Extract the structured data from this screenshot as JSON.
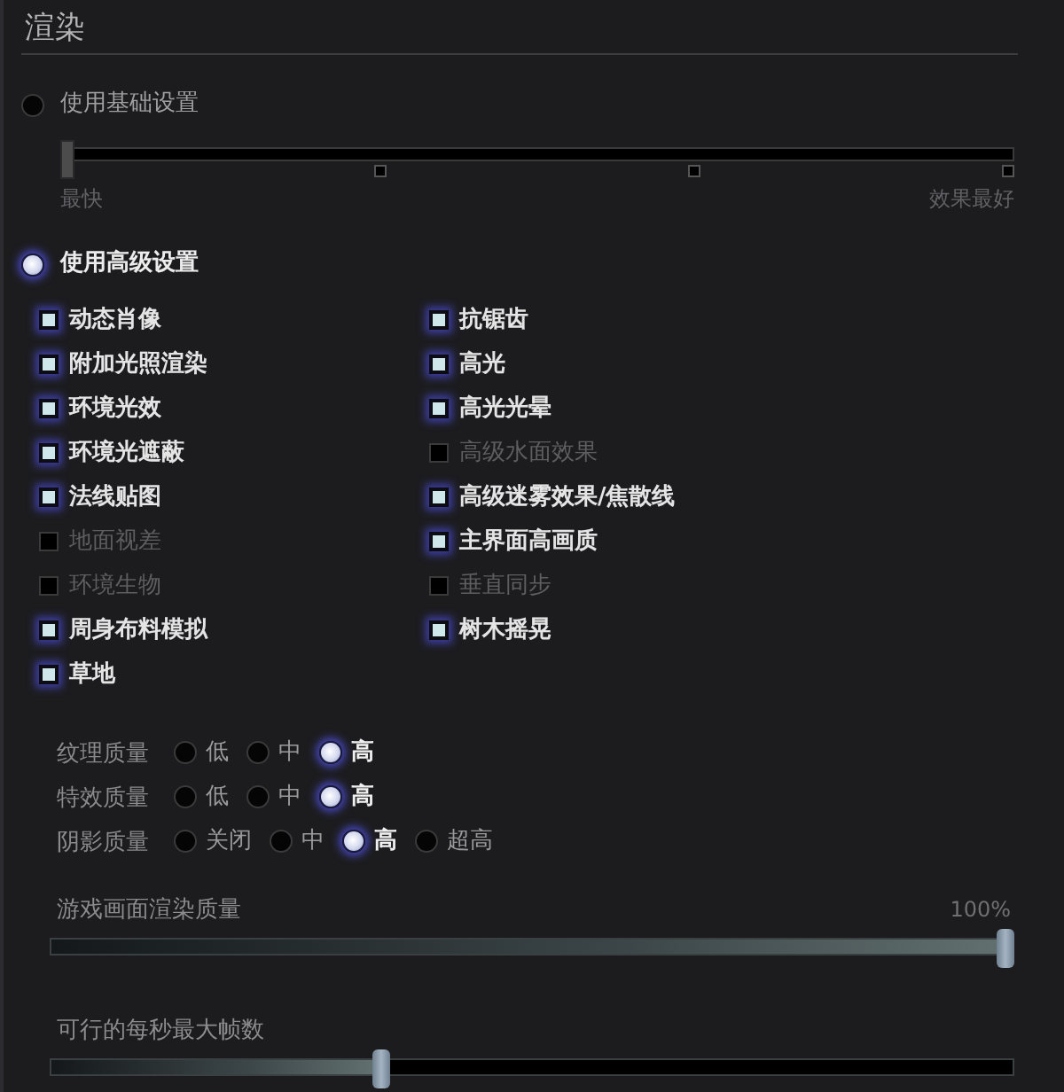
{
  "section": {
    "title": "渲染"
  },
  "modes": [
    {
      "label": "使用基础设置",
      "selected": false,
      "slider": {
        "level": 0,
        "start_label": "最快",
        "end_label": "效果最好"
      }
    },
    {
      "label": "使用高级设置",
      "selected": true
    }
  ],
  "options_left": [
    {
      "label": "动态肖像",
      "checked": true
    },
    {
      "label": "附加光照渲染",
      "checked": true
    },
    {
      "label": "环境光效",
      "checked": true
    },
    {
      "label": "环境光遮蔽",
      "checked": true
    },
    {
      "label": "法线贴图",
      "checked": true
    },
    {
      "label": "地面视差",
      "checked": false
    },
    {
      "label": "环境生物",
      "checked": false
    },
    {
      "label": "周身布料模拟",
      "checked": true
    },
    {
      "label": "草地",
      "checked": true
    }
  ],
  "options_right": [
    {
      "label": "抗锯齿",
      "checked": true
    },
    {
      "label": "高光",
      "checked": true
    },
    {
      "label": "高光光晕",
      "checked": true
    },
    {
      "label": "高级水面效果",
      "checked": false
    },
    {
      "label": "高级迷雾效果/焦散线",
      "checked": true
    },
    {
      "label": "主界面高画质",
      "checked": true
    },
    {
      "label": "垂直同步",
      "checked": false
    },
    {
      "label": "树木摇晃",
      "checked": true
    }
  ],
  "quality": [
    {
      "label": "纹理质量",
      "choices": [
        {
          "label": "低",
          "selected": false
        },
        {
          "label": "中",
          "selected": false
        },
        {
          "label": "高",
          "selected": true
        }
      ]
    },
    {
      "label": "特效质量",
      "choices": [
        {
          "label": "低",
          "selected": false
        },
        {
          "label": "中",
          "selected": false
        },
        {
          "label": "高",
          "selected": true
        }
      ]
    },
    {
      "label": "阴影质量",
      "choices": [
        {
          "label": "关闭",
          "selected": false
        },
        {
          "label": "中",
          "selected": false
        },
        {
          "label": "高",
          "selected": true
        },
        {
          "label": "超高",
          "selected": false
        }
      ]
    }
  ],
  "sliders": [
    {
      "label": "游戏画面渲染质量",
      "reading": "100%",
      "level": 1
    },
    {
      "label": "可行的每秒最大帧数",
      "level": 0.34
    }
  ]
}
